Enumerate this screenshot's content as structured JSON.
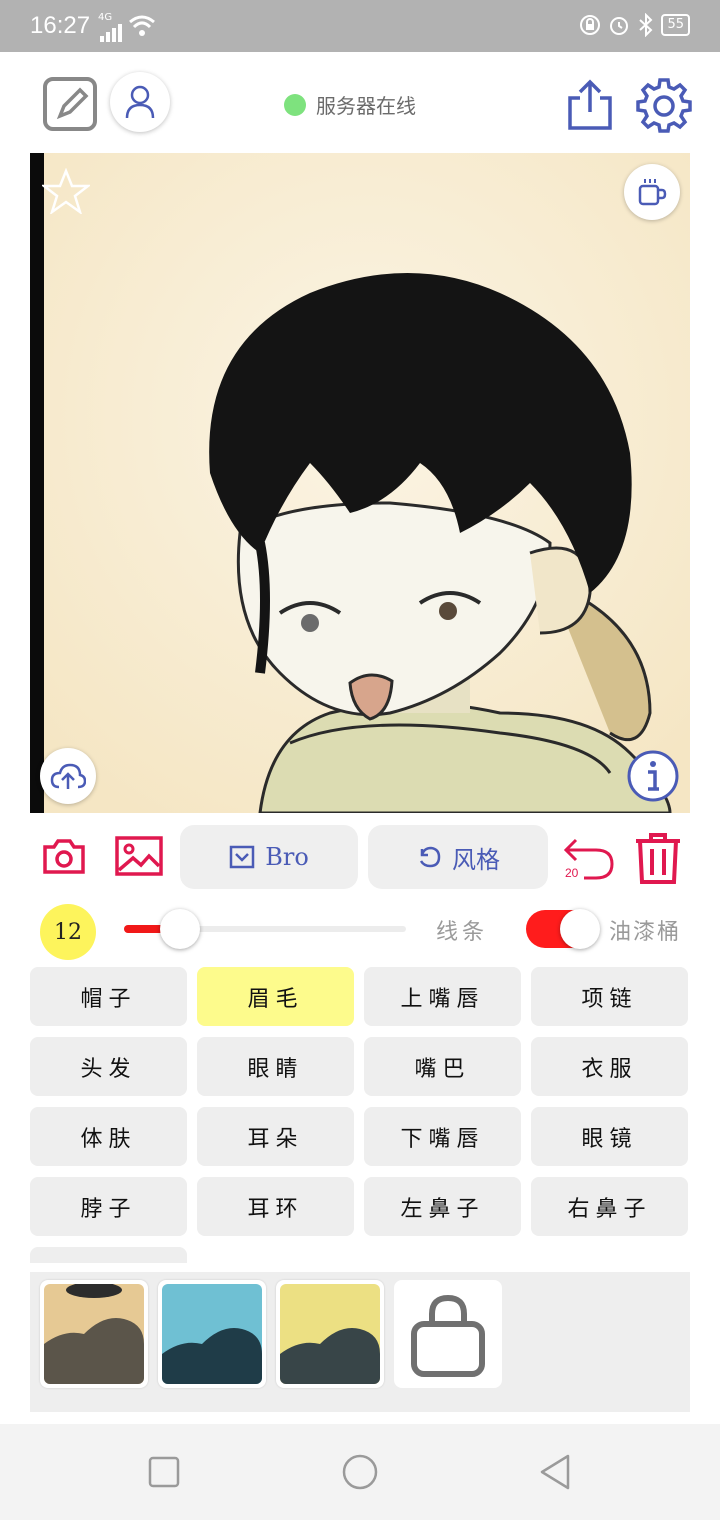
{
  "status_bar": {
    "time": "16:27",
    "network": "4G",
    "battery": "55"
  },
  "header": {
    "server_status": "服务器在线",
    "server_color": "#7ee27e"
  },
  "canvas": {
    "description_icons": [
      "star-icon",
      "cup-icon",
      "cloud-upload-icon",
      "info-icon"
    ]
  },
  "tools": {
    "brush_label": "Bro",
    "style_label": "风格",
    "undo_count": "20"
  },
  "slider": {
    "size": "12",
    "line_label": "线条",
    "bucket_label": "油漆桶",
    "value_fraction": 0.2,
    "bucket_enabled": true
  },
  "parts": [
    "帽子",
    "眉毛",
    "上嘴唇",
    "项链",
    "头发",
    "眼睛",
    "嘴巴",
    "衣服",
    "体肤",
    "耳朵",
    "下嘴唇",
    "眼镜",
    "脖子",
    "耳环",
    "左鼻子",
    "右鼻子"
  ],
  "active_part": "眉毛",
  "colors": {
    "accent_red": "#e0184f",
    "accent_blue": "#4a5bb6",
    "toggle_red": "#ff1c1c",
    "highlight_yellow": "#fdfb8c"
  }
}
